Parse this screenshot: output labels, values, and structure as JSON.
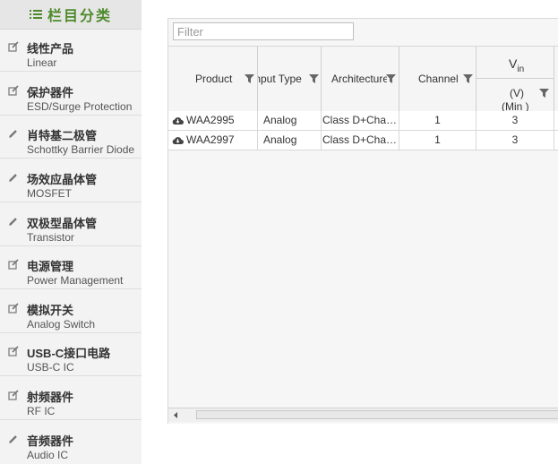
{
  "sidebar": {
    "title": "栏目分类",
    "title_icon": "list-icon",
    "items": [
      {
        "zh": "线性产品",
        "en": "Linear",
        "icon": "edit-icon"
      },
      {
        "zh": "保护器件",
        "en": "ESD/Surge Protection",
        "icon": "edit-icon"
      },
      {
        "zh": "肖特基二极管",
        "en": "Schottky Barrier Diode",
        "icon": "pencil-icon"
      },
      {
        "zh": "场效应晶体管",
        "en": "MOSFET",
        "icon": "pencil-icon"
      },
      {
        "zh": "双极型晶体管",
        "en": "Transistor",
        "icon": "pencil-icon"
      },
      {
        "zh": "电源管理",
        "en": "Power Management",
        "icon": "edit-icon"
      },
      {
        "zh": "模拟开关",
        "en": "Analog Switch",
        "icon": "edit-icon"
      },
      {
        "zh": "USB-C接口电路",
        "en": "USB-C IC",
        "icon": "edit-icon"
      },
      {
        "zh": "射频器件",
        "en": "RF IC",
        "icon": "edit-icon"
      },
      {
        "zh": "音频器件",
        "en": "Audio IC",
        "icon": "pencil-icon"
      }
    ]
  },
  "grid": {
    "filter_placeholder": "Filter",
    "columns": {
      "product": "Product",
      "input_type": "Input Type",
      "architecture": "Architecture",
      "channel": "Channel",
      "vin_main": "V",
      "vin_sub": "in",
      "vin_unit": "(V)",
      "vin_min": "(Min )"
    },
    "rows": [
      {
        "product": "WAA2995",
        "input_type": "Analog",
        "architecture": "Class D+Cha…",
        "channel": "1",
        "vin_min": "3"
      },
      {
        "product": "WAA2997",
        "input_type": "Analog",
        "architecture": "Class D+Cha…",
        "channel": "1",
        "vin_min": "3"
      }
    ]
  },
  "colors": {
    "accent_green": "#4d8a2a",
    "sidebar_bg": "#f3f3f3",
    "grid_bg": "#f6f6f6"
  }
}
